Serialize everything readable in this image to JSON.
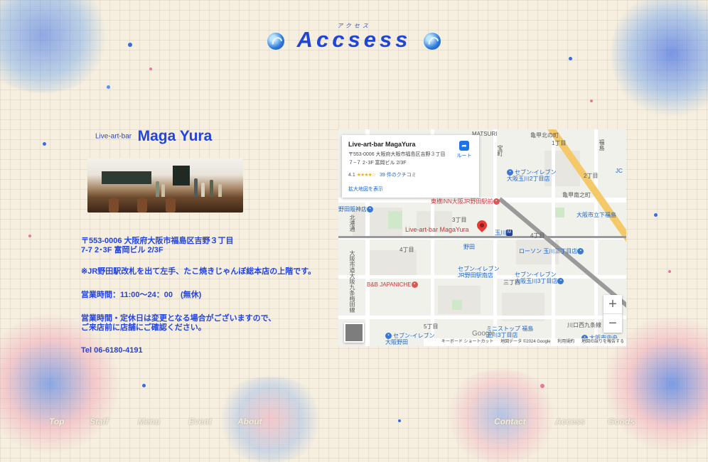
{
  "header": {
    "ruby": "アクセス",
    "title": "Accsess"
  },
  "shop": {
    "brand_prefix": "Live-art-bar",
    "brand_name": "Maga Yura",
    "address": "〒553-0006 大阪府大阪市福島区吉野３丁目\n7-7 2･3F 富岡ビル 2/3F",
    "directions": "※JR野田駅改札を出て左手、たこ焼きじゃんぼ総本店の上階です。",
    "hours": "営業時間：11:00〜24：00　(無休)",
    "notice": "営業時間・定休日は変更となる場合がございますので、\nご来店前に店舗にご確認ください。",
    "tel": "Tel 06-6180-4191"
  },
  "map": {
    "card_name": "Live-art-bar MagaYura",
    "card_address": "〒553-0006 大阪府大阪市福島区吉野３丁目７−７ 2･3F 富岡ビル 2/3F",
    "rating": "4.1",
    "stars": "★★★★☆",
    "reviews": "39 件のクチコミ",
    "enlarge": "拡大地図を表示",
    "route": "ルート",
    "pin_label": "Live-art-bar MagaYura",
    "zoom_in": "+",
    "zoom_out": "−",
    "google": "Google",
    "attribution": [
      "キーボード ショートカット",
      "地図データ ©2024 Google",
      "利用規約",
      "地図の誤りを報告する"
    ],
    "labels": {
      "matsuri": "MATSURI",
      "seven_tamagawa2": "セブン-イレブン\n大阪玉川2丁目店",
      "toyoko": "東横INN大阪JR野田駅前",
      "nodahanshin": "野田阪神店",
      "noda": "野田",
      "tamagawa_station": "玉川",
      "lawson": "ローソン 玉川三丁目店",
      "seven_noda_minami": "セブン-イレブン\nJR野田駅南店",
      "seven_tamagawa3": "セブン-イレブン\n大阪玉川3丁目店",
      "bb": "B&B JAPANICHE",
      "ministop": "ミニストップ 福島\n玉川3丁目店",
      "seven_nodabashi": "セブン-イレブン\n大阪野田",
      "osaka_city_shop": "大阪市立下福島",
      "osaka_city_central": "大阪市中央",
      "jc": "JC",
      "fukushima": "福島",
      "kita_1": "亀甲北の町",
      "kita_2": "亀甲南之町",
      "c1": "1丁目",
      "c2": "2丁目",
      "c3": "3丁目",
      "c4": "4丁目",
      "c4b": "4丁目",
      "c5": "5丁目",
      "kawaguchi": "川口西九条線",
      "sanjo": "三丁目",
      "nodaline": "大阪市道大阪九条梅田線",
      "hokko": "北港通",
      "takaramachi": "宝町"
    }
  },
  "nav": {
    "top": "Top",
    "staff": "Staff",
    "menu": "Menu",
    "event": "Event",
    "about": "About",
    "contact": "Contact",
    "access": "Access",
    "goods": "Goods"
  }
}
